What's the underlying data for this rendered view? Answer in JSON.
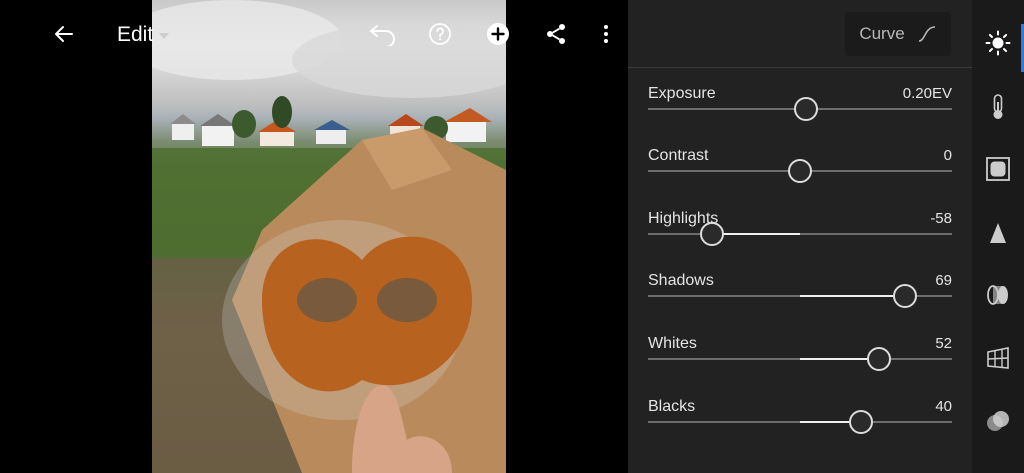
{
  "header": {
    "edit_label": "Edit",
    "icons": [
      "back-arrow-icon",
      "undo-icon",
      "help-icon",
      "add-icon",
      "share-icon",
      "more-vertical-icon"
    ]
  },
  "panel": {
    "curve_label": "Curve",
    "sliders": [
      {
        "label": "Exposure",
        "value": "0.20EV",
        "range": [
          -5,
          5
        ],
        "numeric": 0.2
      },
      {
        "label": "Contrast",
        "value": "0",
        "range": [
          -100,
          100
        ],
        "numeric": 0
      },
      {
        "label": "Highlights",
        "value": "-58",
        "range": [
          -100,
          100
        ],
        "numeric": -58
      },
      {
        "label": "Shadows",
        "value": "69",
        "range": [
          -100,
          100
        ],
        "numeric": 69
      },
      {
        "label": "Whites",
        "value": "52",
        "range": [
          -100,
          100
        ],
        "numeric": 52
      },
      {
        "label": "Blacks",
        "value": "40",
        "range": [
          -100,
          100
        ],
        "numeric": 40
      }
    ]
  },
  "rail": {
    "items": [
      "light-icon",
      "color-temperature-icon",
      "effects-icon",
      "detail-icon",
      "optics-icon",
      "geometry-icon",
      "presets-icon"
    ],
    "active": "light-icon",
    "accent_color": "#2d7be0"
  }
}
